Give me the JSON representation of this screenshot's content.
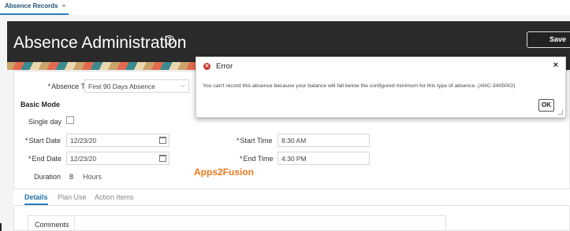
{
  "tabs": [
    {
      "label": "Absence Records",
      "close": "×"
    }
  ],
  "header": {
    "title": "Absence Administration",
    "help_icon": "help-circle-icon",
    "save_label": "Save"
  },
  "form": {
    "absence_type": {
      "label": "Absence Type",
      "value": "First 90 Days Absence"
    },
    "section_title": "Basic Mode",
    "single_day": {
      "label": "Single day",
      "checked": false
    },
    "start_date": {
      "label": "Start Date",
      "value": "12/23/20"
    },
    "end_date": {
      "label": "End Date",
      "value": "12/23/20"
    },
    "start_time": {
      "label": "Start Time",
      "value": "8:30 AM"
    },
    "end_time": {
      "label": "End Time",
      "value": "4:30 PM"
    },
    "duration": {
      "label": "Duration",
      "value": "8",
      "unit": "Hours"
    },
    "required_mark": "*"
  },
  "detail_tabs": [
    "Details",
    "Plan Use",
    "Action Items"
  ],
  "comments": {
    "label": "Comments"
  },
  "watermark": "Apps2Fusion",
  "dialog": {
    "title": "Error",
    "close": "×",
    "message": "You can't record this absence because your balance will fall below the configured minimum for this type of absence. (ANC-3405002)",
    "ok_label": "OK"
  },
  "colors": {
    "error": "#c8342b",
    "accent": "#2a7bbf",
    "banner": "#2a2a2a",
    "watermark": "#e87a1e"
  }
}
